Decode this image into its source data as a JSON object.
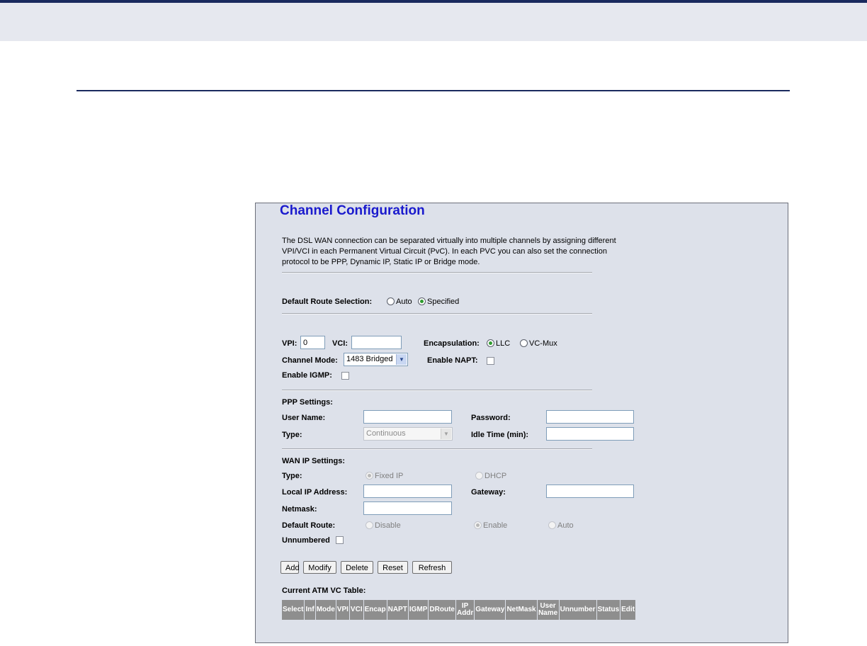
{
  "title": "Channel Configuration",
  "description": "The DSL WAN connection can be separated virtually into multiple channels by assigning different VPI/VCI in each Permanent Virtual Circuit (PvC). In each PVC you can also set the connection protocol to be PPP, Dynamic IP, Static IP or Bridge mode.",
  "default_route": {
    "label": "Default Route Selection:",
    "options": [
      "Auto",
      "Specified"
    ],
    "selected": "Specified"
  },
  "vpi": {
    "label": "VPI:",
    "value": "0"
  },
  "vci": {
    "label": "VCI:",
    "value": ""
  },
  "encapsulation": {
    "label": "Encapsulation:",
    "options": [
      "LLC",
      "VC-Mux"
    ],
    "selected": "LLC"
  },
  "channel_mode": {
    "label": "Channel Mode:",
    "value": "1483 Bridged"
  },
  "enable_napt": {
    "label": "Enable NAPT:",
    "checked": false
  },
  "enable_igmp": {
    "label": "Enable IGMP:",
    "checked": false
  },
  "ppp": {
    "heading": "PPP Settings:",
    "user_name_label": "User Name:",
    "user_name": "",
    "password_label": "Password:",
    "password": "",
    "type_label": "Type:",
    "type_value": "Continuous",
    "idle_label": "Idle Time (min):",
    "idle_value": ""
  },
  "wan_ip": {
    "heading": "WAN IP Settings:",
    "type_label": "Type:",
    "type_options": [
      "Fixed IP",
      "DHCP"
    ],
    "type_selected": "Fixed IP",
    "local_ip_label": "Local IP Address:",
    "local_ip": "",
    "gateway_label": "Gateway:",
    "gateway": "",
    "netmask_label": "Netmask:",
    "netmask": "",
    "default_route_label": "Default Route:",
    "default_route_options": [
      "Disable",
      "Enable",
      "Auto"
    ],
    "default_route_selected": "Enable",
    "unnumbered_label": "Unnumbered",
    "unnumbered": false
  },
  "buttons": {
    "add": "Add",
    "modify": "Modify",
    "delete": "Delete",
    "reset": "Reset",
    "refresh": "Refresh"
  },
  "table": {
    "caption": "Current ATM VC Table:",
    "columns": [
      "Select",
      "Inf",
      "Mode",
      "VPI",
      "VCI",
      "Encap",
      "NAPT",
      "IGMP",
      "DRoute",
      "IP Addr",
      "Gateway",
      "NetMask",
      "User Name",
      "Unnumber",
      "Status",
      "Edit"
    ]
  },
  "colors": {
    "title": "#1a1acd",
    "panel_bg": "#dde1ea",
    "header_band": "#e6e8ef",
    "rule": "#1a2a5e",
    "table_header": "#8e8e8e"
  }
}
